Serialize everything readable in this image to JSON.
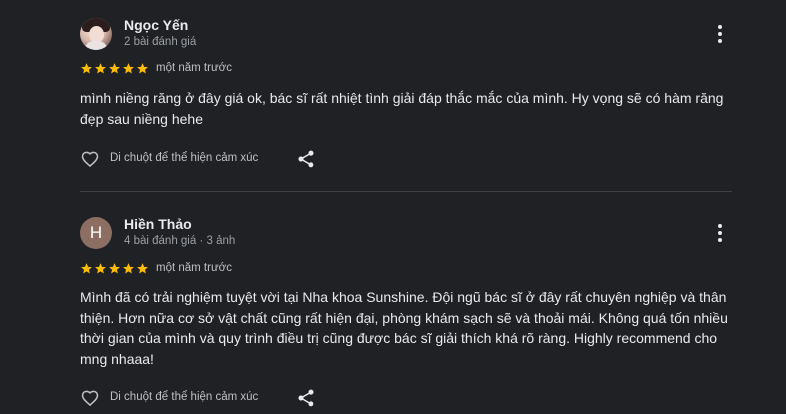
{
  "reviews": [
    {
      "author": "Ngọc Yến",
      "meta": "2 bài đánh giá",
      "avatar": {
        "type": "photo",
        "letter": ""
      },
      "rating": 5,
      "time": "một năm trước",
      "text": "mình niềng răng ở đây giá ok, bác sĩ rất nhiệt tình giải đáp thắc mắc của mình. Hy vọng sẽ có hàm răng đẹp sau niềng hehe",
      "react_label": "Di chuột để thể hiện cảm xúc"
    },
    {
      "author": "Hiền Thảo",
      "meta": "4 bài đánh giá · 3 ảnh",
      "avatar": {
        "type": "letter",
        "letter": "H",
        "color": "#8d6e63"
      },
      "rating": 5,
      "time": "một năm trước",
      "text": "Mình đã có trải nghiệm tuyệt vời tại Nha khoa Sunshine. Đội ngũ bác sĩ ở đây rất chuyên nghiệp và thân thiện. Hơn nữa cơ sở vật chất cũng rất hiện đại, phòng khám sạch sẽ và thoải mái. Không quá tốn nhiều thời gian của mình và quy trình điều trị cũng được bác sĩ giải thích khá rõ ràng. Highly recommend cho mng nhaaa!",
      "react_label": "Di chuột để thể hiện cảm xúc"
    }
  ],
  "colors": {
    "background": "#202124",
    "star": "#fbbc04",
    "text": "#e8eaed",
    "secondary_text": "#9aa0a6",
    "divider": "#3c4043"
  },
  "icons": {
    "more": "kebab-menu-icon",
    "react": "heart-outline-icon",
    "share": "share-icon",
    "star": "star-icon"
  }
}
